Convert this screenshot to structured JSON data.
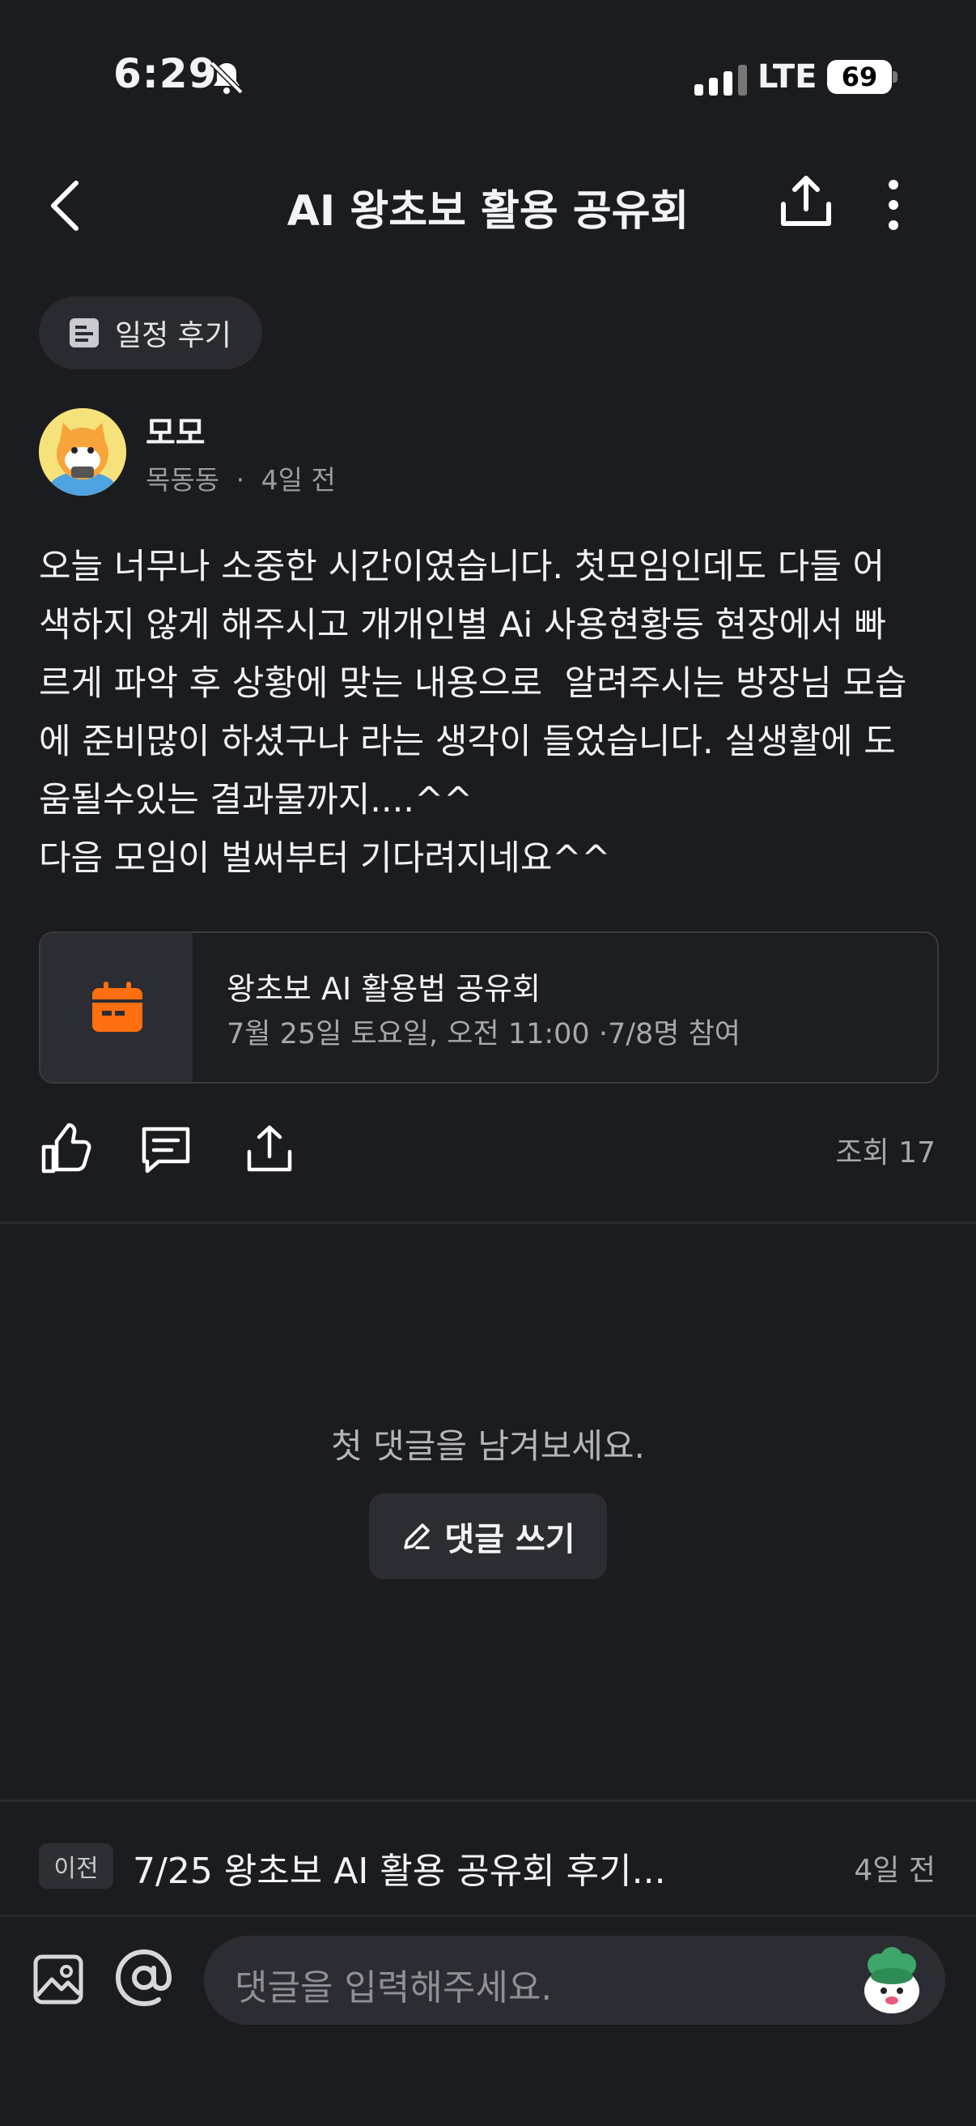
{
  "status_bar": {
    "time": "6:29",
    "network": "LTE",
    "battery": "69"
  },
  "header": {
    "title": "AI 왕초보 활용 공유회"
  },
  "tag": {
    "label": "일정 후기"
  },
  "author": {
    "name": "모모",
    "location": "목동동",
    "separator": "·",
    "time_ago": "4일 전"
  },
  "post": {
    "body": "오늘 너무나 소중한 시간이였습니다. 첫모임인데도 다들 어\n색하지 않게 해주시고 개개인별 Ai 사용현황등 현장에서 빠\n르게 파악 후 상황에 맞는 내용으로  알려주시는 방장님 모습\n에 준비많이 하셨구나 라는 생각이 들었습니다. 실생활에 도\n움될수있는 결과물까지....^^\n다음 모임이 벌써부터 기다려지네요^^"
  },
  "event_card": {
    "title": "왕초보 AI 활용법 공유회",
    "subtitle": "7월 25일 토요일, 오전 11:00  ·7/8명 참여",
    "accent": "#ff6f0f"
  },
  "actions": {
    "views": "조회 17"
  },
  "comments": {
    "empty_text": "첫 댓글을 남겨보세요.",
    "write_label": "댓글 쓰기"
  },
  "prev_post": {
    "badge": "이전",
    "title": "7/25 왕초보 AI 활용 공유회 후기...",
    "time": "4일 전"
  },
  "composer": {
    "placeholder": "댓글을 입력해주세요."
  },
  "icons": [
    "bell-mute-icon",
    "signal-icon",
    "back-icon",
    "share-icon",
    "more-icon",
    "note-icon",
    "calendar-icon",
    "like-icon",
    "comment-icon",
    "pencil-icon",
    "image-icon",
    "at-icon",
    "sticker-icon"
  ]
}
